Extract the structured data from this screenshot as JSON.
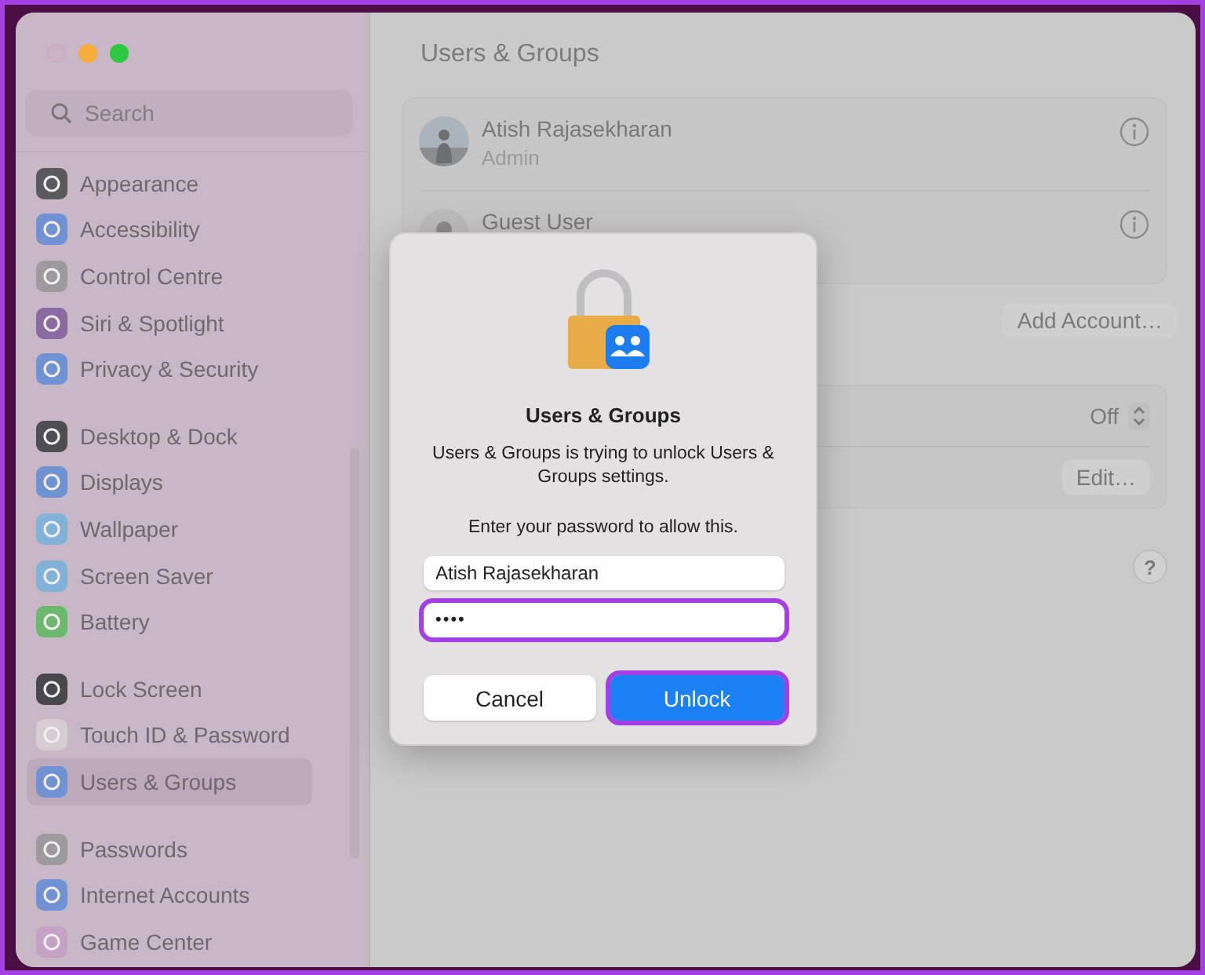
{
  "sidebar": {
    "search": {
      "placeholder": "Search"
    },
    "groups": [
      {
        "items": [
          {
            "label": "Appearance",
            "color": "#5a5a5e",
            "selected": false
          },
          {
            "label": "Accessibility",
            "color": "#6f93d2",
            "selected": false
          },
          {
            "label": "Control Centre",
            "color": "#9c9a9c",
            "selected": false
          },
          {
            "label": "Siri & Spotlight",
            "color": "#8a6aa0",
            "selected": false
          },
          {
            "label": "Privacy & Security",
            "color": "#6f93d2",
            "selected": false
          }
        ]
      },
      {
        "items": [
          {
            "label": "Desktop & Dock",
            "color": "#4e4e52",
            "selected": false
          },
          {
            "label": "Displays",
            "color": "#6f93d2",
            "selected": false
          },
          {
            "label": "Wallpaper",
            "color": "#82b2d8",
            "selected": false
          },
          {
            "label": "Screen Saver",
            "color": "#82b2d8",
            "selected": false
          },
          {
            "label": "Battery",
            "color": "#6cb86c",
            "selected": false
          }
        ]
      },
      {
        "items": [
          {
            "label": "Lock Screen",
            "color": "#48484c",
            "selected": false
          },
          {
            "label": "Touch ID & Password",
            "color": "#d6cdd2",
            "selected": false
          },
          {
            "label": "Users & Groups",
            "color": "#6f93d2",
            "selected": true
          }
        ]
      },
      {
        "items": [
          {
            "label": "Passwords",
            "color": "#9c9a9c",
            "selected": false
          },
          {
            "label": "Internet Accounts",
            "color": "#6f93d2",
            "selected": false
          },
          {
            "label": "Game Center",
            "color": "#c4a2c4",
            "selected": false
          }
        ]
      }
    ]
  },
  "main": {
    "title": "Users & Groups",
    "accounts": [
      {
        "name": "Atish Rajasekharan",
        "role": "Admin"
      },
      {
        "kind": "guest",
        "name": "Guest User"
      }
    ],
    "add_button": "Add Account…",
    "settings": [
      {
        "kind": "popup",
        "value": "Off"
      },
      {
        "kind": "button",
        "label": "Edit…"
      }
    ],
    "help_button": "?"
  },
  "dialog": {
    "title": "Users & Groups",
    "message": "Users & Groups is trying to unlock Users & Groups settings.",
    "prompt": "Enter your password to allow this.",
    "fields": [
      {
        "kind": "text",
        "value": "Atish Rajasekharan",
        "highlighted": false
      },
      {
        "kind": "password",
        "value": "••••",
        "highlighted": true
      }
    ],
    "buttons": [
      {
        "label": "Cancel",
        "primary": false,
        "highlighted": false
      },
      {
        "label": "Unlock",
        "primary": true,
        "highlighted": true
      }
    ]
  }
}
